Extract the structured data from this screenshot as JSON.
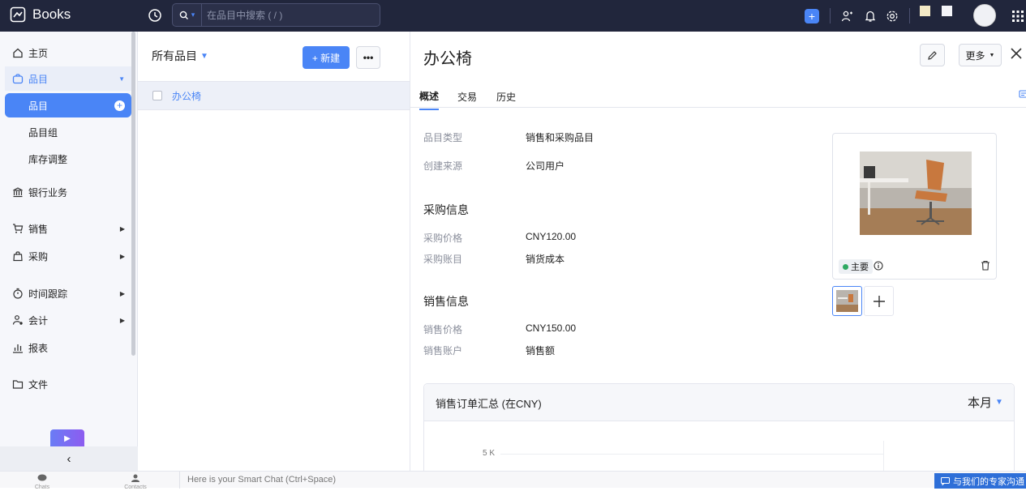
{
  "app": {
    "name": "Books"
  },
  "search": {
    "placeholder": "在品目中搜索 ( / )"
  },
  "sidebar": {
    "items": [
      {
        "label": "主页"
      },
      {
        "label": "品目"
      },
      {
        "label": "品目"
      },
      {
        "label": "品目组"
      },
      {
        "label": "库存调整"
      },
      {
        "label": "银行业务"
      },
      {
        "label": "销售"
      },
      {
        "label": "采购"
      },
      {
        "label": "时间跟踪"
      },
      {
        "label": "会计"
      },
      {
        "label": "报表"
      },
      {
        "label": "文件"
      }
    ]
  },
  "list": {
    "title": "所有品目",
    "new_label": "+ 新建",
    "rows": [
      {
        "name": "办公椅"
      }
    ]
  },
  "detail": {
    "title": "办公椅",
    "more_label": "更多",
    "tabs": [
      "概述",
      "交易",
      "历史"
    ],
    "fields": [
      {
        "label": "品目类型",
        "value": "销售和采购品目"
      },
      {
        "label": "创建来源",
        "value": "公司用户"
      }
    ],
    "purchase": {
      "heading": "采购信息",
      "rows": [
        {
          "label": "采购价格",
          "value": "CNY120.00"
        },
        {
          "label": "采购账目",
          "value": "销货成本"
        }
      ]
    },
    "sales": {
      "heading": "销售信息",
      "rows": [
        {
          "label": "销售价格",
          "value": "CNY150.00"
        },
        {
          "label": "销售账户",
          "value": "销售额"
        }
      ]
    },
    "image_badge": "主要",
    "summary": {
      "title": "销售订单汇总 (在CNY)",
      "period": "本月",
      "y_tick": "5 K"
    }
  },
  "bottom": {
    "chat_placeholder": "Here is your Smart Chat (Ctrl+Space)",
    "chats_label": "Chats",
    "contacts_label": "Contacts",
    "expert_label": "与我们的专家沟通"
  },
  "colors": {
    "accent": "#4a85f6",
    "topbar": "#21263c",
    "sidebar_bg": "#f6f7fb"
  }
}
